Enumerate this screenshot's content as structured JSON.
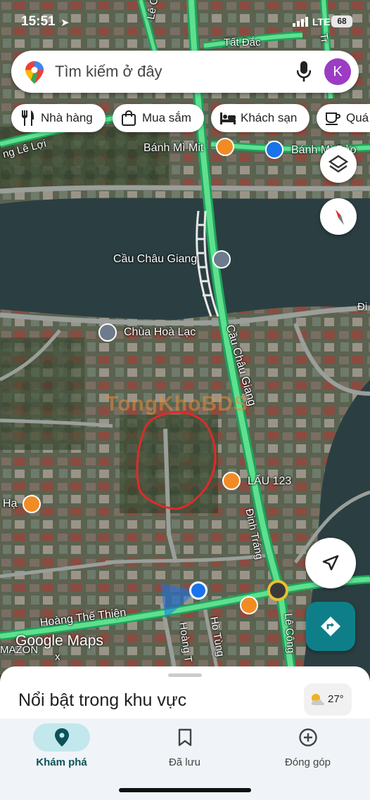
{
  "status_bar": {
    "time": "15:51",
    "network": "LTE",
    "battery": "68"
  },
  "search": {
    "placeholder": "Tìm kiếm ở đây",
    "avatar_letter": "K"
  },
  "chips": [
    {
      "label": "Nhà hàng",
      "icon": "fork-knife-icon"
    },
    {
      "label": "Mua sắm",
      "icon": "shopping-bag-icon"
    },
    {
      "label": "Khách sạn",
      "icon": "bed-icon"
    },
    {
      "label": "Quá",
      "icon": "cup-icon"
    }
  ],
  "map": {
    "streets": {
      "le_cong_top": "Lê Công",
      "tat_dac": "Tất Đắc",
      "tra_top": "Tr",
      "le_loi": "ng Lê Lợi",
      "cau_chau_giang_road": "Cầu Châu Giang",
      "dinh_trang": "Đinh Tráng",
      "hoang_the_thien": "Hoàng Thế Thiện",
      "hoang_vertical": "Hoàng T",
      "ho_tung": "Hồ Tùng",
      "le_cong_bottom": "Lê Công",
      "di": "Đi",
      "x_letter": "x"
    },
    "places": {
      "banh_mi_mit": "Bánh Mì Mit",
      "banh_mi_bao": "Bánh Mì Bảo",
      "cau_chau_giang": "Cầu Châu Giang",
      "chua_hoa_lac": "Chùa Hoà Lạc",
      "lau_123": "LẨU 123",
      "ha": "Hạ",
      "mazon": "MAZON"
    },
    "watermark": "TongKhoBDS",
    "logo": "Google Maps",
    "accent_colors": {
      "road": "#3fd07a",
      "food_poi": "#f28b24",
      "pin_blue": "#1a73e8",
      "drawn_outline": "#e02a2a",
      "fab_teal": "#0e7f89"
    }
  },
  "sheet": {
    "title": "Nổi bật trong khu vực",
    "temperature": "27°"
  },
  "nav": [
    {
      "label": "Khám phá",
      "icon": "location-pin-icon",
      "active": true
    },
    {
      "label": "Đã lưu",
      "icon": "bookmark-icon",
      "active": false
    },
    {
      "label": "Đóng góp",
      "icon": "add-circle-icon",
      "active": false
    }
  ]
}
